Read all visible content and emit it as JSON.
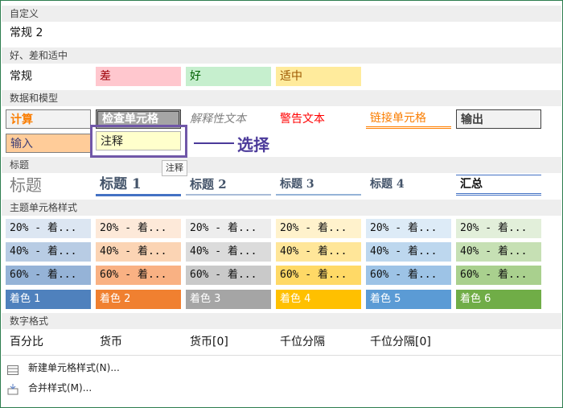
{
  "sections": {
    "custom": "自定义",
    "good_bad": "好、差和适中",
    "data_model": "数据和模型",
    "titles": "标题",
    "theme": "主题单元格样式",
    "number": "数字格式"
  },
  "custom_row": {
    "normal2": "常规 2"
  },
  "good_bad_row": {
    "normal": "常规",
    "bad": "差",
    "good": "好",
    "neutral": "适中"
  },
  "data_row1": {
    "calc": "计算",
    "check": "检查单元格",
    "explain": "解释性文本",
    "warn": "警告文本",
    "linked": "链接单元格",
    "output": "输出"
  },
  "data_row2": {
    "input": "输入",
    "note": "注释"
  },
  "annotation": {
    "callout": "选择",
    "tooltip": "注释"
  },
  "title_row": {
    "title": "标题",
    "h1": "标题 1",
    "h2": "标题 2",
    "h3": "标题 3",
    "h4": "标题 4",
    "total": "汇总"
  },
  "theme_rows": [
    [
      "20% - 着...",
      "20% - 着...",
      "20% - 着...",
      "20% - 着...",
      "20% - 着...",
      "20% - 着..."
    ],
    [
      "40% - 着...",
      "40% - 着...",
      "40% - 着...",
      "40% - 着...",
      "40% - 着...",
      "40% - 着..."
    ],
    [
      "60% - 着...",
      "60% - 着...",
      "60% - 着...",
      "60% - 着...",
      "60% - 着...",
      "60% - 着..."
    ],
    [
      "着色 1",
      "着色 2",
      "着色 3",
      "着色 4",
      "着色 5",
      "着色 6"
    ]
  ],
  "number_row": [
    "百分比",
    "货币",
    "货币[0]",
    "千位分隔",
    "千位分隔[0]"
  ],
  "footer": {
    "new_style": "新建单元格样式(N)...",
    "merge_style": "合并样式(M)..."
  },
  "colors": {
    "accent1": [
      "#dce6f2",
      "#b8cce4",
      "#95b3d7",
      "#4f81bd"
    ],
    "accent2": [
      "#fde9d9",
      "#fbd4b4",
      "#f9b183",
      "#f08030"
    ],
    "accent3": [
      "#ededed",
      "#dbdbdb",
      "#c9c9c9",
      "#a5a5a5"
    ],
    "accent4": [
      "#fff2cc",
      "#ffe699",
      "#ffd966",
      "#ffc000"
    ],
    "accent5": [
      "#ddebf7",
      "#bdd7ee",
      "#9dc3e6",
      "#5b9bd5"
    ],
    "accent6": [
      "#e2efda",
      "#c6e0b4",
      "#a9d08e",
      "#70ad47"
    ]
  }
}
